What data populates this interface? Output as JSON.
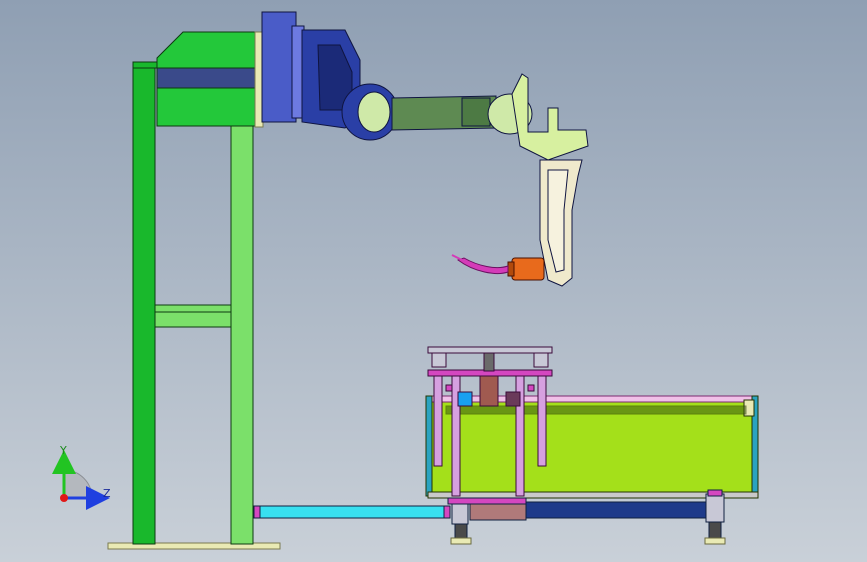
{
  "viewport": {
    "background_top": "#8f9fb3",
    "background_bottom": "#c9d0d8"
  },
  "triad": {
    "y_label": "Y",
    "z_label": "Z",
    "colors": {
      "y": "#22c422",
      "z": "#1f3fe0",
      "x": "#e01818"
    }
  },
  "colors": {
    "gantry_green": "#19b82c",
    "gantry_light": "#7be06a",
    "robot_blue": "#2a3fa6",
    "robot_blue_dark": "#1b2a78",
    "arm_green": "#5e8a52",
    "arm_light": "#cfe9a8",
    "torch_orange": "#e86a1c",
    "torch_magenta": "#d43bb8",
    "table_yellowgreen": "#a4e01a",
    "rail_cyan": "#38e0f0",
    "rail_blue": "#1e3a8a",
    "frame_magenta": "#d447c0",
    "base_plate": "#e9eab4",
    "gray_part": "#b7b7bd"
  }
}
